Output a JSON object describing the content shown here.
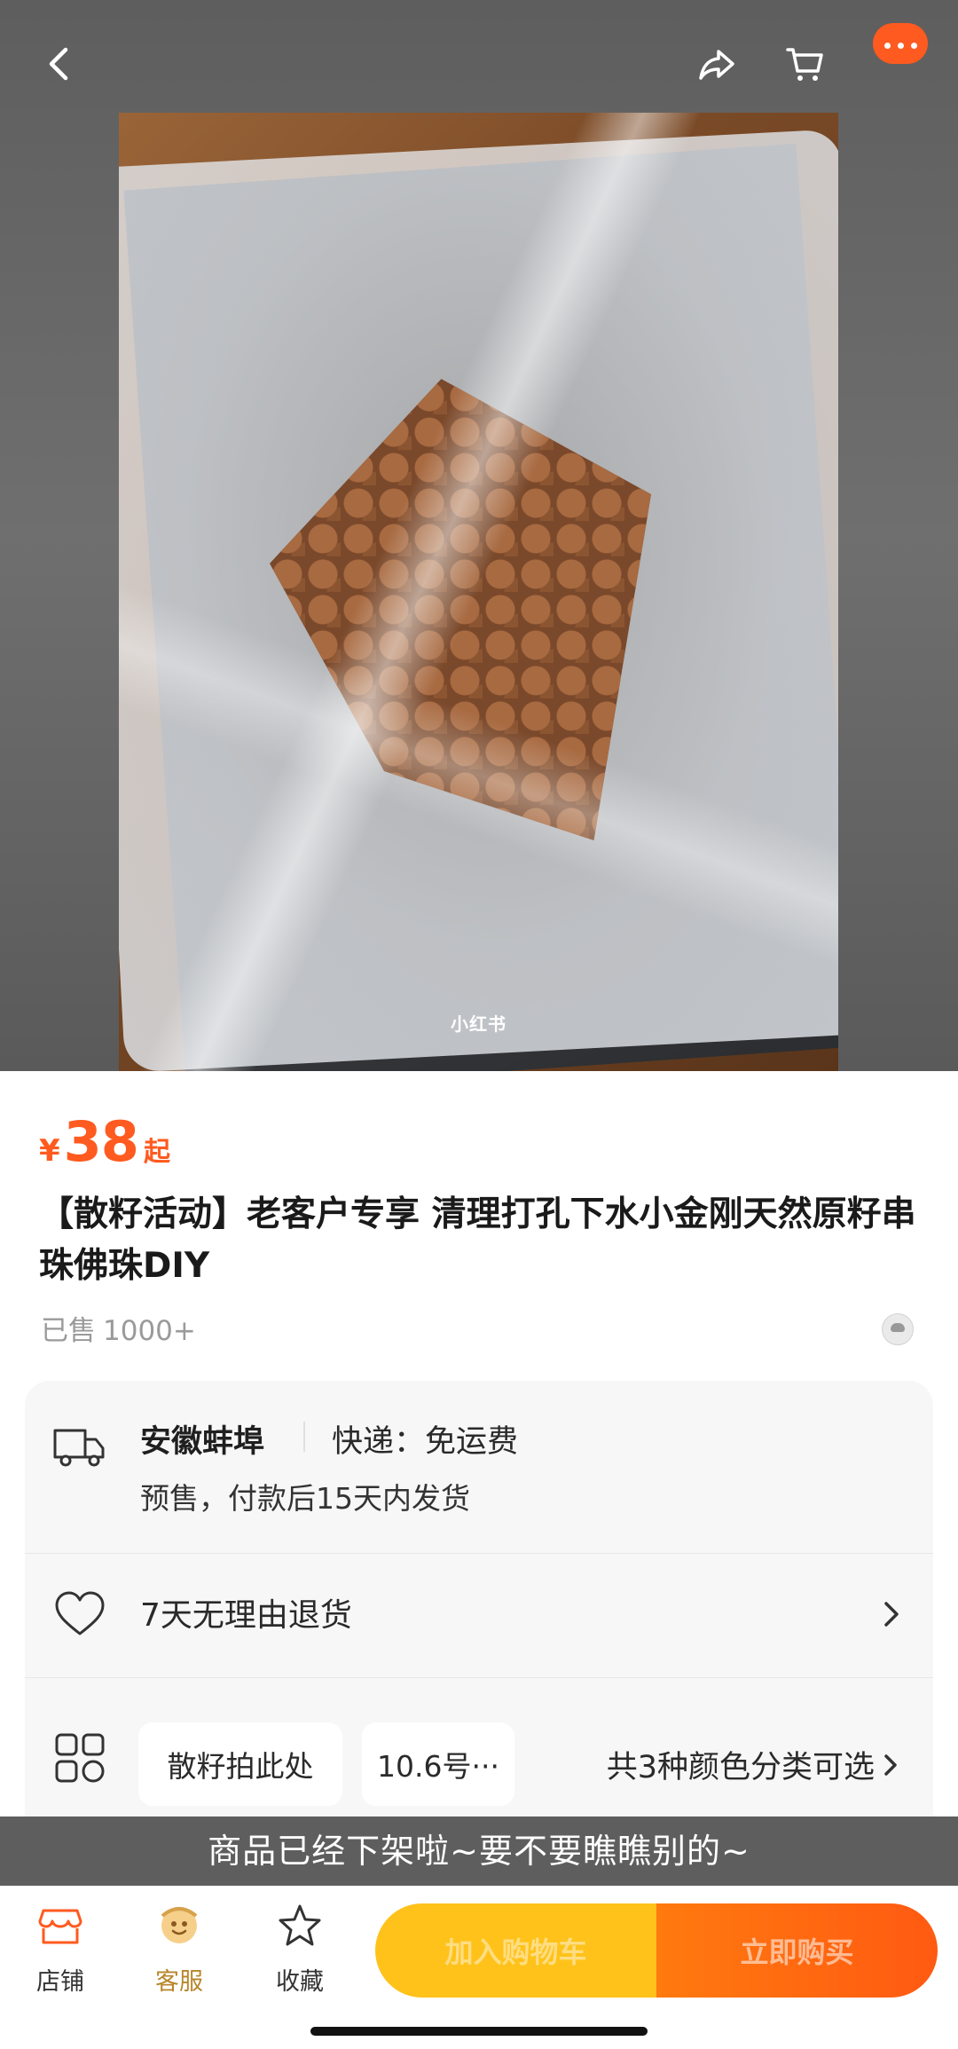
{
  "product": {
    "image_watermark": "小红书",
    "price_symbol": "¥",
    "price": "38",
    "price_suffix": "起",
    "title": "【散籽活动】老客户专享 清理打孔下水小金刚天然原籽串珠佛珠DIY",
    "sold_label": "已售",
    "sold_count": "1000+"
  },
  "shipping": {
    "origin": "安徽蚌埠",
    "method": "快递：免运费",
    "note": "预售，付款后15天内发货"
  },
  "returns": {
    "text": "7天无理由退货"
  },
  "options": {
    "pill_1": "散籽拍此处",
    "pill_2": "10.6号···",
    "more": "共3种颜色分类可选"
  },
  "banner": {
    "text": "商品已经下架啦~要不要瞧瞧别的~"
  },
  "bottom_bar": {
    "shop": "店铺",
    "service": "客服",
    "favorite": "收藏",
    "add_to_cart": "加入购物车",
    "buy_now": "立即购买"
  },
  "colors": {
    "accent": "#ff5a1f",
    "cart_button": "#ffc21a",
    "buy_button": "#ff6a12",
    "service_icon": "#d6a24a"
  },
  "icons": [
    "back-icon",
    "share-icon",
    "cart-icon",
    "more-icon",
    "truck-icon",
    "heart-icon",
    "grid-icon",
    "chevron-right-icon",
    "shop-icon",
    "service-icon",
    "star-icon"
  ]
}
